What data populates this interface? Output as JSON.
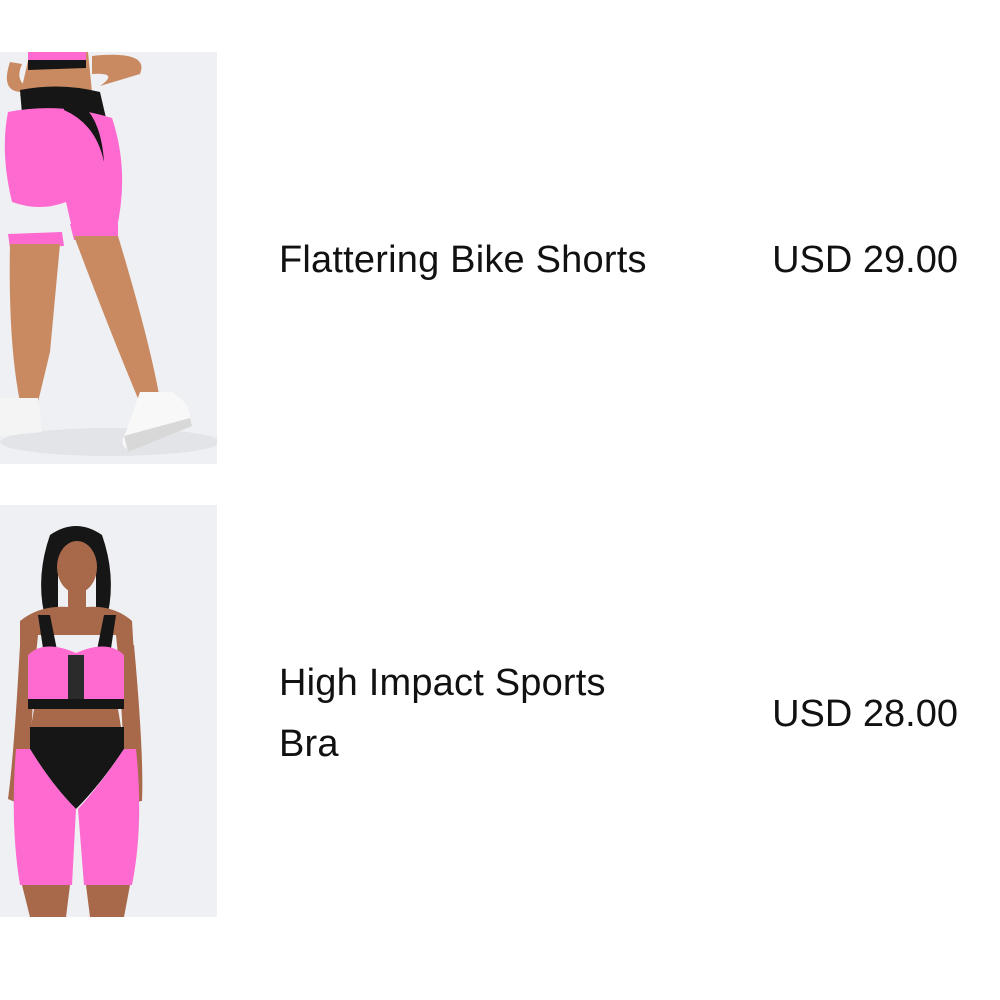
{
  "colors": {
    "background": "#ffffff",
    "text": "#111111",
    "thumb_bg": "#eef0f3",
    "product_pink": "#ff6ad0",
    "product_black": "#161616",
    "skin": "#c98a62"
  },
  "products": [
    {
      "name": "Flattering Bike Shorts",
      "price": "USD 29.00",
      "image_icon": "bike-shorts-photo"
    },
    {
      "name": "High Impact Sports Bra",
      "price": "USD 28.00",
      "image_icon": "sports-bra-photo"
    }
  ]
}
